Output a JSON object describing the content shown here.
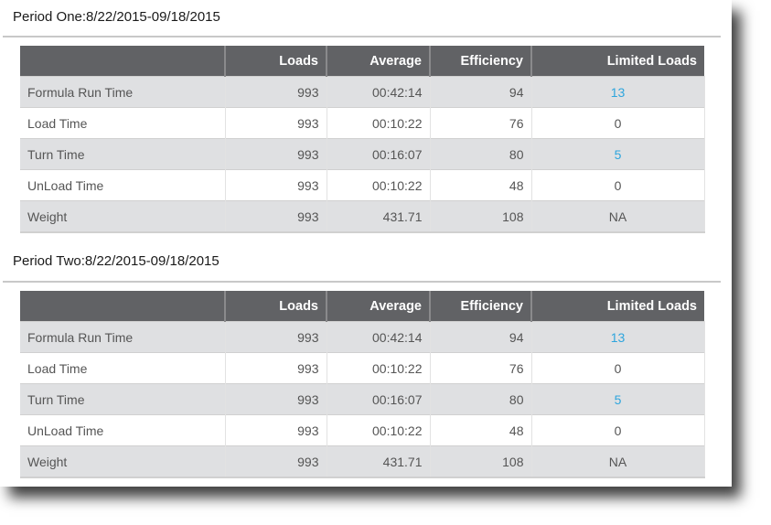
{
  "colors": {
    "header_bg": "#616265",
    "row_odd_bg": "#dfe0e2",
    "row_even_bg": "#ffffff",
    "link": "#2ea5dd",
    "text": "#555555"
  },
  "columns": [
    "",
    "Loads",
    "Average",
    "Efficiency",
    "Limited Loads"
  ],
  "periods": [
    {
      "title": "Period One:8/22/2015-09/18/2015",
      "rows": [
        {
          "label": "Formula Run Time",
          "loads": "993",
          "average": "00:42:14",
          "efficiency": "94",
          "limited_loads": "13",
          "limited_is_link": true
        },
        {
          "label": "Load Time",
          "loads": "993",
          "average": "00:10:22",
          "efficiency": "76",
          "limited_loads": "0",
          "limited_is_link": false
        },
        {
          "label": "Turn Time",
          "loads": "993",
          "average": "00:16:07",
          "efficiency": "80",
          "limited_loads": "5",
          "limited_is_link": true
        },
        {
          "label": "UnLoad Time",
          "loads": "993",
          "average": "00:10:22",
          "efficiency": "48",
          "limited_loads": "0",
          "limited_is_link": false
        },
        {
          "label": "Weight",
          "loads": "993",
          "average": "431.71",
          "efficiency": "108",
          "limited_loads": "NA",
          "limited_is_link": false
        }
      ]
    },
    {
      "title": "Period Two:8/22/2015-09/18/2015",
      "rows": [
        {
          "label": "Formula Run Time",
          "loads": "993",
          "average": "00:42:14",
          "efficiency": "94",
          "limited_loads": "13",
          "limited_is_link": true
        },
        {
          "label": "Load Time",
          "loads": "993",
          "average": "00:10:22",
          "efficiency": "76",
          "limited_loads": "0",
          "limited_is_link": false
        },
        {
          "label": "Turn Time",
          "loads": "993",
          "average": "00:16:07",
          "efficiency": "80",
          "limited_loads": "5",
          "limited_is_link": true
        },
        {
          "label": "UnLoad Time",
          "loads": "993",
          "average": "00:10:22",
          "efficiency": "48",
          "limited_loads": "0",
          "limited_is_link": false
        },
        {
          "label": "Weight",
          "loads": "993",
          "average": "431.71",
          "efficiency": "108",
          "limited_loads": "NA",
          "limited_is_link": false
        }
      ]
    }
  ]
}
